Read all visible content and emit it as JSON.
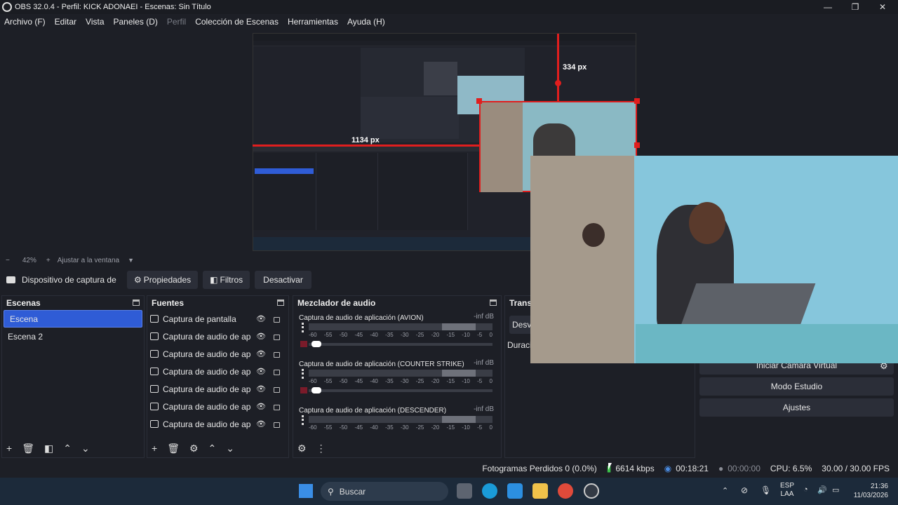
{
  "window": {
    "title": "OBS 32.0.4 - Perfil: KICK ADONAEI - Escenas: Sin Título",
    "minimize": "—",
    "maximize": "❐",
    "close": "✕"
  },
  "menu": {
    "items": [
      "Archivo (F)",
      "Editar",
      "Vista",
      "Paneles (D)",
      "Perfil",
      "Colección de Escenas",
      "Herramientas",
      "Ayuda (H)"
    ]
  },
  "preview": {
    "measure_vertical": "334 px",
    "measure_horizontal": "1134 px",
    "accent_red": "#e01e1e"
  },
  "zoom": {
    "minus": "−",
    "level": "42%",
    "plus": "+",
    "fit_label": "Ajustar a la ventana"
  },
  "source_toolbar": {
    "source_name": "Dispositivo de captura de v",
    "properties": "Propiedades",
    "filters": "Filtros",
    "deactivate": "Desactivar"
  },
  "scenes": {
    "title": "Escenas",
    "items": [
      "Escena",
      "Escena 2"
    ],
    "selected_index": 0,
    "selected_color": "#2f5cd6"
  },
  "sources": {
    "title": "Fuentes",
    "items": [
      "Captura de pantalla",
      "Captura de audio de ap",
      "Captura de audio de ap",
      "Captura de audio de ap",
      "Captura de audio de ap",
      "Captura de audio de ap",
      "Captura de audio de ap"
    ]
  },
  "mixer": {
    "title": "Mezclador de audio",
    "ticks": [
      "-60",
      "-55",
      "-50",
      "-45",
      "-40",
      "-35",
      "-30",
      "-25",
      "-20",
      "-15",
      "-10",
      "-5",
      "0"
    ],
    "channels": [
      {
        "name": "Captura de audio de aplicación (AVION)",
        "db": "-inf dB"
      },
      {
        "name": "Captura de audio de aplicación (COUNTER STRIKE)",
        "db": "-inf dB"
      },
      {
        "name": "Captura de audio de aplicación (DESCENDER)",
        "db": "-inf dB"
      }
    ]
  },
  "transitions": {
    "title": "Transi",
    "fade": "Desva",
    "duration_label": "Duraci"
  },
  "controls": {
    "virtual_camera": "Iniciar Cámara Virtual",
    "studio_mode": "Modo Estudio",
    "settings": "Ajustes"
  },
  "status": {
    "dropped_frames": "Fotogramas Perdidos 0 (0.0%)",
    "bitrate": "6614 kbps",
    "stream_time": "00:18:21",
    "rec_time": "00:00:00",
    "cpu": "CPU: 6.5%",
    "fps": "30.00 / 30.00 FPS"
  },
  "taskbar": {
    "search": "Buscar",
    "lang_top": "ESP",
    "lang_bottom": "LAA",
    "time": "21:36",
    "date": "11/03/2026"
  }
}
